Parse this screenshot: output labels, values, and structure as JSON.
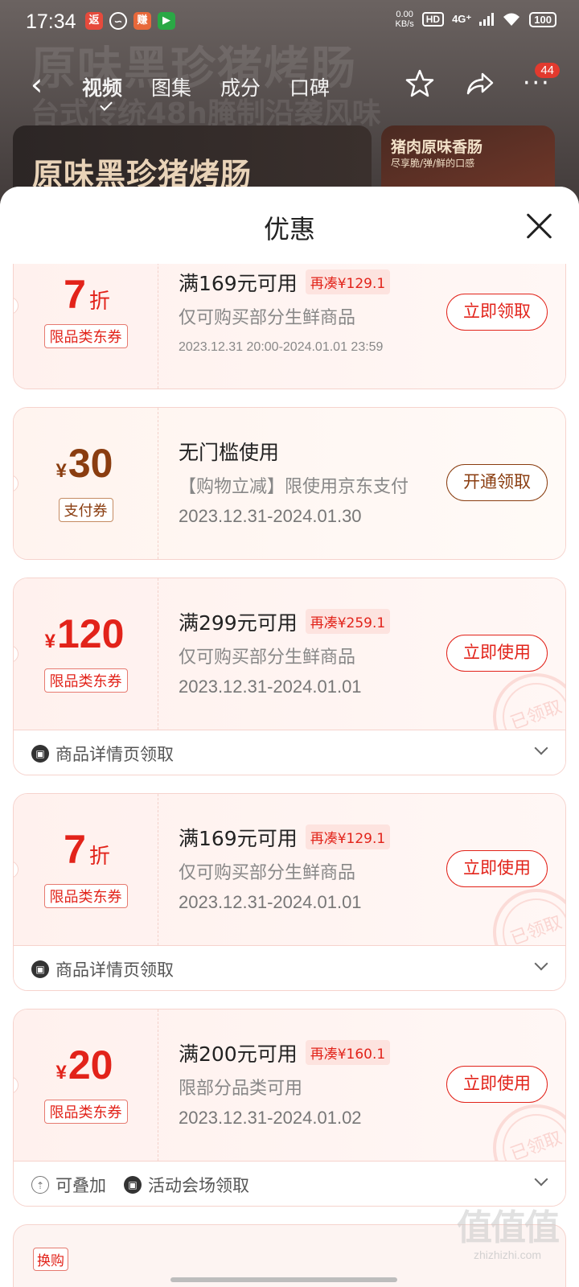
{
  "status_bar": {
    "time": "17:34",
    "app_icons": [
      "返",
      "∽",
      "赚",
      "▶"
    ],
    "network_speed_value": "0.00",
    "network_speed_unit": "KB/s",
    "hd_label": "HD",
    "signal_label": "4G⁺",
    "battery": "100"
  },
  "background": {
    "headline": "原味黑珍猪烤肠",
    "subline": "台式传统48h腌制沿袭风味",
    "tabs": [
      "视频",
      "图集",
      "成分",
      "口碑"
    ],
    "badge_count": "44",
    "banner_left_text": "原味黑珍猪烤肠",
    "banner_right_title": "猪肉原味香肠",
    "banner_right_sub": "尽享脆/弹/鲜的口感"
  },
  "sheet": {
    "title": "优惠"
  },
  "coupons": [
    {
      "amount_prefix": "",
      "amount": "7",
      "amount_suffix": "折",
      "tag": "限品类东券",
      "title": "满169元可用",
      "chip": "再凑¥129.1",
      "desc": "仅可购买部分生鲜商品",
      "date": "2023.12.31 20:00-2024.01.01 23:59",
      "button": "立即领取"
    },
    {
      "amount_prefix": "¥",
      "amount": "30",
      "amount_suffix": "",
      "tag": "支付券",
      "title": "无门槛使用",
      "chip": "",
      "desc": "【购物立减】限使用京东支付",
      "date": "2023.12.31-2024.01.30",
      "button": "开通领取"
    },
    {
      "amount_prefix": "¥",
      "amount": "120",
      "amount_suffix": "",
      "tag": "限品类东券",
      "title": "满299元可用",
      "chip": "再凑¥259.1",
      "desc": "仅可购买部分生鲜商品",
      "date": "2023.12.31-2024.01.01",
      "button": "立即使用",
      "stamp": "已领取",
      "footer": [
        "商品详情页领取"
      ]
    },
    {
      "amount_prefix": "",
      "amount": "7",
      "amount_suffix": "折",
      "tag": "限品类东券",
      "title": "满169元可用",
      "chip": "再凑¥129.1",
      "desc": "仅可购买部分生鲜商品",
      "date": "2023.12.31-2024.01.01",
      "button": "立即使用",
      "stamp": "已领取",
      "footer": [
        "商品详情页领取"
      ]
    },
    {
      "amount_prefix": "¥",
      "amount": "20",
      "amount_suffix": "",
      "tag": "限品类东券",
      "title": "满200元可用",
      "chip": "再凑¥160.1",
      "desc": "限部分品类可用",
      "date": "2023.12.31-2024.01.02",
      "button": "立即使用",
      "stamp": "已领取",
      "footer": [
        "可叠加",
        "活动会场领取"
      ]
    }
  ],
  "next_card_tag": "换购",
  "watermark": {
    "logo": "值值值",
    "url": "zhizhizhi.com"
  },
  "colors": {
    "accent_red": "#e2231a",
    "gold_brown": "#8a3d10",
    "coupon_bg": "#fff1ee"
  }
}
